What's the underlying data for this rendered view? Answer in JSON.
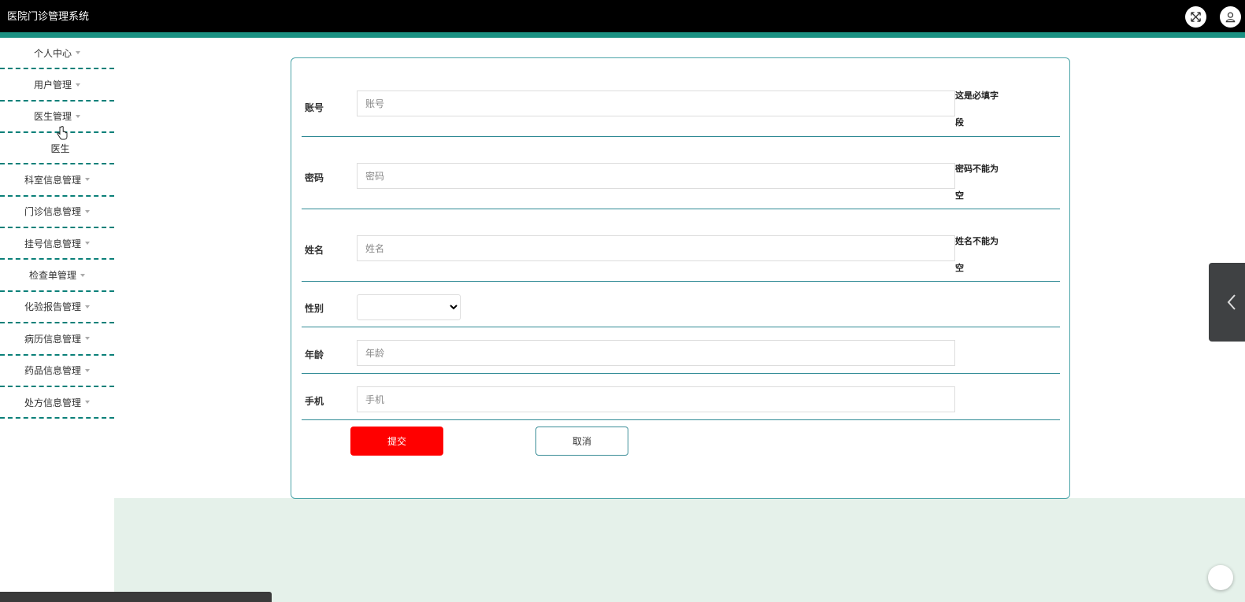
{
  "app": {
    "title": "医院门诊管理系统"
  },
  "topbar": {
    "icons": {
      "fullscreen": "fullscreen-icon",
      "user": "user-icon"
    },
    "colors": {
      "bar": "#000000",
      "stripe": "#1a9182"
    }
  },
  "sidebar": {
    "items": [
      {
        "label": "个人中心"
      },
      {
        "label": "用户管理"
      },
      {
        "label": "医生管理",
        "expanded": true,
        "children": [
          {
            "label": "医生"
          }
        ]
      },
      {
        "label": "科室信息管理"
      },
      {
        "label": "门诊信息管理"
      },
      {
        "label": "挂号信息管理"
      },
      {
        "label": "检查单管理"
      },
      {
        "label": "化验报告管理"
      },
      {
        "label": "病历信息管理"
      },
      {
        "label": "药品信息管理"
      },
      {
        "label": "处方信息管理"
      }
    ]
  },
  "form": {
    "fields": {
      "account": {
        "label": "账号",
        "placeholder": "账号",
        "value": "",
        "error": "这是必填字段"
      },
      "password": {
        "label": "密码",
        "placeholder": "密码",
        "value": "",
        "error": "密码不能为空"
      },
      "name": {
        "label": "姓名",
        "placeholder": "姓名",
        "value": "",
        "error": "姓名不能为空"
      },
      "gender": {
        "label": "性别",
        "selected": ""
      },
      "age": {
        "label": "年龄",
        "placeholder": "年龄",
        "value": ""
      },
      "phone": {
        "label": "手机",
        "placeholder": "手机",
        "value": ""
      }
    },
    "buttons": {
      "submit": "提交",
      "cancel": "取消"
    },
    "colors": {
      "submit": "#ff0000",
      "border": "#4ba4a8"
    }
  }
}
